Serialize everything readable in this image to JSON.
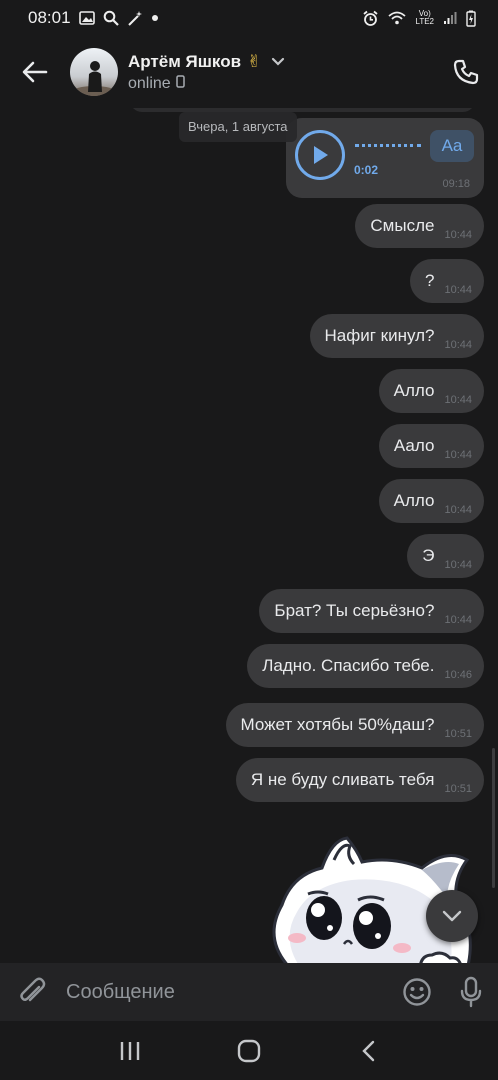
{
  "status_bar": {
    "time": "08:01",
    "lte_top": "Vo)",
    "lte_bottom": "LTE2"
  },
  "header": {
    "contact_name": "Артём Яшков",
    "name_emoji": "✌",
    "status": "online"
  },
  "chat": {
    "date_chip": "Вчера, 1 августа",
    "voice_message": {
      "duration": "0:02",
      "transcribe_label": "Aa",
      "time": "09:18",
      "progress": 0
    },
    "messages": [
      {
        "text": "Смысле",
        "time": "10:44"
      },
      {
        "text": "?",
        "time": "10:44"
      },
      {
        "text": "Нафиг кинул?",
        "time": "10:44"
      },
      {
        "text": "Алло",
        "time": "10:44"
      },
      {
        "text": "Аало",
        "time": "10:44"
      },
      {
        "text": "Алло",
        "time": "10:44"
      },
      {
        "text": "Э",
        "time": "10:44"
      },
      {
        "text": "Брат? Ты серьёзно?",
        "time": "10:44"
      },
      {
        "text": "Ладно. Спасибо  тебе.",
        "time": "10:46"
      },
      {
        "text": "Может хотябы 50%даш?",
        "time": "10:51"
      },
      {
        "text": "Я не буду сливать тебя",
        "time": "10:51"
      }
    ]
  },
  "composer": {
    "placeholder": "Сообщение"
  },
  "colors": {
    "background": "#19191a",
    "bubble": "#3a3a3c",
    "accent": "#71aaeb",
    "composer": "#232325"
  },
  "icons": {
    "back": "arrow-left-icon",
    "call": "phone-icon",
    "attach": "paperclip-icon",
    "emoji": "smile-icon",
    "mic": "microphone-icon",
    "play": "play-icon",
    "scroll_down": "chevron-down-icon"
  }
}
